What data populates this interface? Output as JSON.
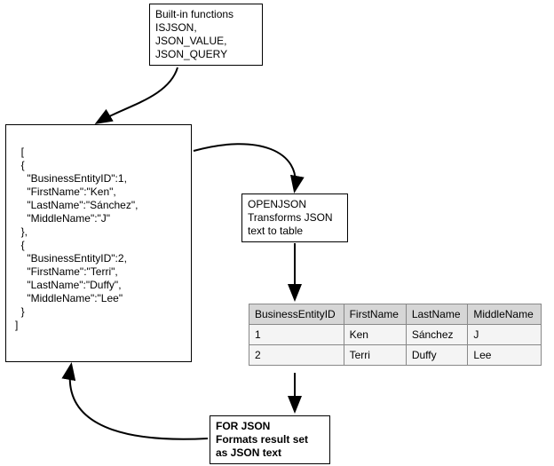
{
  "builtins_box": {
    "line1": "Built-in functions",
    "line2": "ISJSON,",
    "line3": "JSON_VALUE,",
    "line4": "JSON_QUERY"
  },
  "json_text": "[\n  {\n    \"BusinessEntityID\":1,\n    \"FirstName\":\"Ken\",\n    \"LastName\":\"Sánchez\",\n    \"MiddleName\":\"J\"\n  },\n  {\n    \"BusinessEntityID\":2,\n    \"FirstName\":\"Terri\",\n    \"LastName\":\"Duffy\",\n    \"MiddleName\":\"Lee\"\n  }\n]",
  "openjson_box": {
    "line1": "OPENJSON",
    "line2": "Transforms JSON",
    "line3": "text to table"
  },
  "forjson_box": {
    "line1": "FOR JSON",
    "line2": "Formats result set",
    "line3": "as JSON text"
  },
  "table": {
    "headers": [
      "BusinessEntityID",
      "FirstName",
      "LastName",
      "MiddleName"
    ],
    "rows": [
      [
        "1",
        "Ken",
        "Sánchez",
        "J"
      ],
      [
        "2",
        "Terri",
        "Duffy",
        "Lee"
      ]
    ]
  },
  "chart_data": {
    "type": "table",
    "title": "",
    "columns": [
      "BusinessEntityID",
      "FirstName",
      "LastName",
      "MiddleName"
    ],
    "rows": [
      [
        1,
        "Ken",
        "Sánchez",
        "J"
      ],
      [
        2,
        "Terri",
        "Duffy",
        "Lee"
      ]
    ]
  }
}
